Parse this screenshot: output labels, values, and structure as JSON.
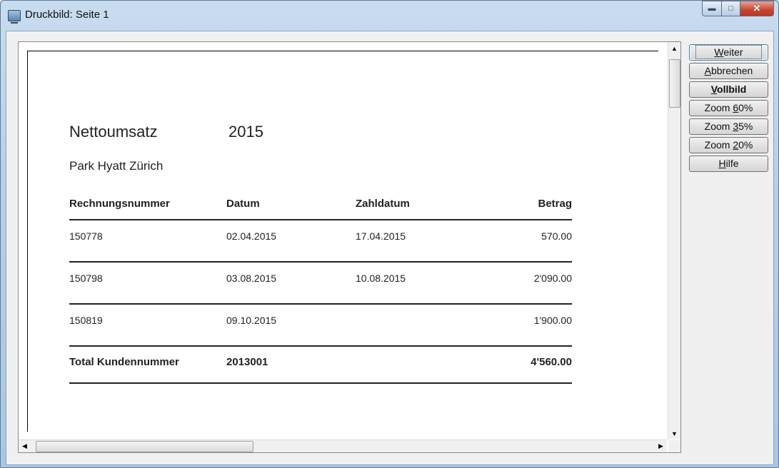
{
  "window": {
    "title": "Druckbild: Seite 1",
    "icon": "print-preview-icon"
  },
  "report": {
    "title": "Nettoumsatz",
    "year": "2015",
    "subtitle": "Park Hyatt Zürich",
    "columns": [
      "Rechnungsnummer",
      "Datum",
      "Zahldatum",
      "Betrag"
    ],
    "rows": [
      [
        "150778",
        "02.04.2015",
        "17.04.2015",
        "570.00"
      ],
      [
        "150798",
        "03.08.2015",
        "10.08.2015",
        "2'090.00"
      ],
      [
        "150819",
        "09.10.2015",
        "",
        "1'900.00"
      ]
    ],
    "total": {
      "label": "Total  Kundennummer",
      "customer": "2013001",
      "amount": "4'560.00"
    }
  },
  "buttons": [
    {
      "pre": "",
      "key": "W",
      "post": "eiter",
      "style": "default"
    },
    {
      "pre": "",
      "key": "A",
      "post": "bbrechen",
      "style": ""
    },
    {
      "pre": "",
      "key": "V",
      "post": "ollbild",
      "style": "bold"
    },
    {
      "pre": "Zoom ",
      "key": "6",
      "post": "0%",
      "style": ""
    },
    {
      "pre": "Zoom ",
      "key": "3",
      "post": "5%",
      "style": ""
    },
    {
      "pre": "Zoom ",
      "key": "2",
      "post": "0%",
      "style": ""
    },
    {
      "pre": "",
      "key": "H",
      "post": "ilfe",
      "style": ""
    }
  ]
}
